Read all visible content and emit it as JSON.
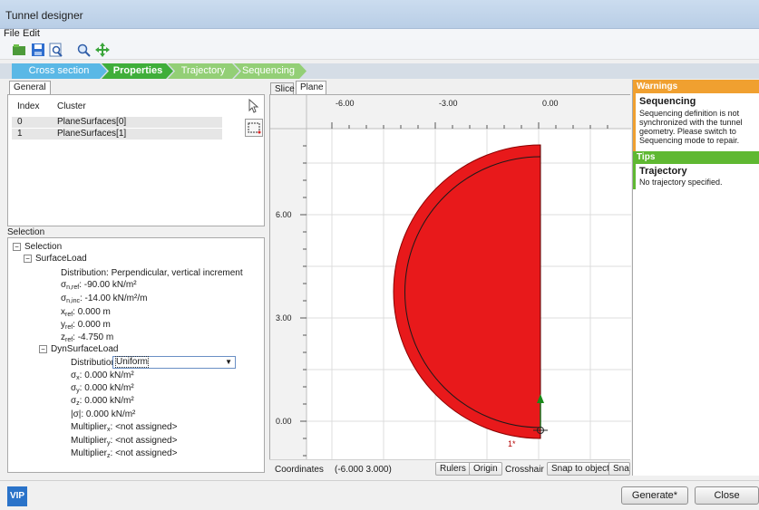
{
  "window": {
    "title": "Tunnel designer"
  },
  "menu": [
    "File",
    "Edit"
  ],
  "wizard": {
    "steps": [
      "Cross section",
      "Properties",
      "Trajectory",
      "Sequencing"
    ]
  },
  "left": {
    "tab_general": "General",
    "table": {
      "headers": [
        "Index",
        "Cluster"
      ],
      "rows": [
        [
          "0",
          "PlaneSurfaces[0]"
        ],
        [
          "1",
          "PlaneSurfaces[1]"
        ]
      ]
    },
    "selection_label": "Selection",
    "tree": {
      "root": "Selection",
      "surface_load": "SurfaceLoad",
      "distribution_1": "Distribution: Perpendicular, vertical increment",
      "sigma_ref_sym": "σ",
      "sigma_ref_sub": "n,ref",
      "sigma_ref_val": ": -90.00 kN/m²",
      "sigma_inc_sym": "σ",
      "sigma_inc_sub": "n,inc",
      "sigma_inc_val": ": -14.00 kN/m²/m",
      "xref_sym": "x",
      "xref_sub": "ref",
      "xref_val": ": 0.000 m",
      "yref_sym": "y",
      "yref_sub": "ref",
      "yref_val": ": 0.000 m",
      "zref_sym": "z",
      "zref_sub": "ref",
      "zref_val": ": -4.750 m",
      "dyn_surface_load": "DynSurfaceLoad",
      "distribution_2_label": "Distribution:",
      "distribution_2_value": "Uniform",
      "sx_sym": "σ",
      "sx_sub": "x",
      "sx_val": ": 0.000 kN/m²",
      "sy_sym": "σ",
      "sy_sub": "y",
      "sy_val": ": 0.000 kN/m²",
      "sz_sym": "σ",
      "sz_sub": "z",
      "sz_val": ": 0.000 kN/m²",
      "sabs": "|σ|: 0.000 kN/m²",
      "mx_sym": "Multiplier",
      "mx_sub": "x",
      "mx_val": ": <not assigned>",
      "my_sym": "Multiplier",
      "my_sub": "y",
      "my_val": ": <not assigned>",
      "mz_sym": "Multiplier",
      "mz_sub": "z",
      "mz_val": ": <not assigned>"
    }
  },
  "view": {
    "tabs": [
      "Slice",
      "Plane"
    ],
    "x_ticks": [
      "-6.00",
      "-3.00",
      "0.00"
    ],
    "y_ticks": [
      "6.00",
      "3.00",
      "0.00"
    ],
    "point_label": "1*",
    "coordinates_label": "Coordinates",
    "coordinates_value": "(-6.000 3.000)",
    "buttons": [
      "Rulers",
      "Origin"
    ],
    "crosshair_label": "Crosshair",
    "snap_buttons": [
      "Snap to object",
      "Sna"
    ],
    "shape_color": "#e8191b"
  },
  "right": {
    "warnings_header": "Warnings",
    "warning_title": "Sequencing",
    "warning_text": "Sequencing definition is not synchronized with the tunnel geometry. Please switch to Sequencing mode to repair.",
    "tips_header": "Tips",
    "tip_title": "Trajectory",
    "tip_text": "No trajectory specified.",
    "warnings_color": "#f0a030",
    "tips_color": "#5fb832"
  },
  "bottom": {
    "logo": "VIP",
    "generate": "Generate*",
    "close": "Close"
  }
}
